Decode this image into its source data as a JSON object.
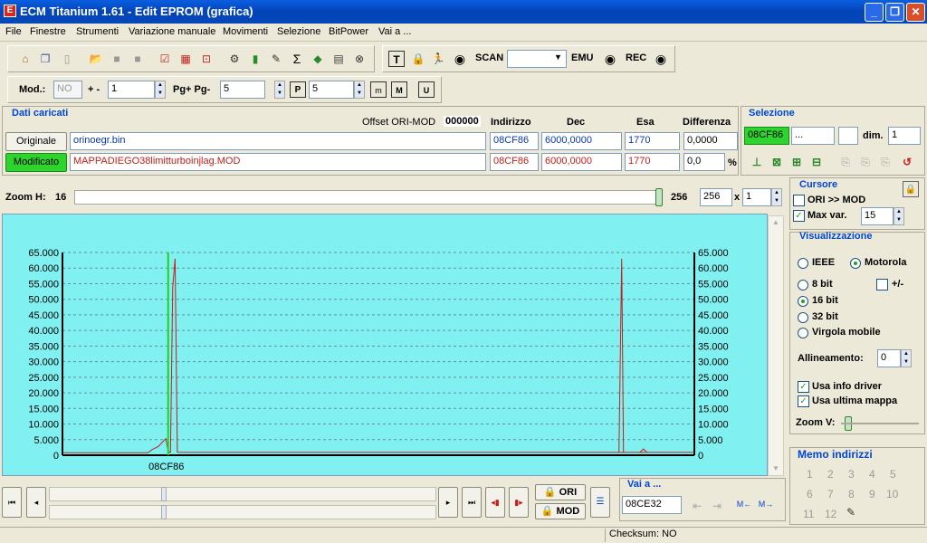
{
  "window": {
    "title": "ECM Titanium 1.61 - Edit EPROM (grafica)",
    "min": "_",
    "max": "❐",
    "close": "✕"
  },
  "menu": [
    "File",
    "Finestre",
    "Strumenti",
    "Variazione manuale",
    "Movimenti",
    "Selezione",
    "BitPower",
    "Vai a ..."
  ],
  "toolbar1": {
    "scan_label": "SCAN",
    "emu_label": "EMU",
    "rec_label": "REC",
    "scan_value": ""
  },
  "toolbar2": {
    "mod_label": "Mod.:",
    "mod_value": "NO",
    "pm_label": "+ -",
    "pm_value": "1",
    "pg_label": "Pg+ Pg-",
    "pg_value": "5",
    "p_value": "5"
  },
  "dati": {
    "title": "Dati caricati",
    "offset_label": "Offset ORI-MOD",
    "offset_value": "000000",
    "col_indirizzo": "Indirizzo",
    "col_dec": "Dec",
    "col_esa": "Esa",
    "col_diff": "Differenza",
    "originale": {
      "label": "Originale",
      "file": "orinoegr.bin",
      "indirizzo": "08CF86",
      "dec": "6000,0000",
      "esa": "1770",
      "diff": "0,0000"
    },
    "modificato": {
      "label": "Modificato",
      "file": "MAPPADIEGO38limitturboinjlag.MOD",
      "indirizzo": "08CF86",
      "dec": "6000,0000",
      "esa": "1770",
      "diff": "0,0",
      "pct": "%"
    }
  },
  "selezione": {
    "title": "Selezione",
    "start": "08CF86",
    "end": "...",
    "dim_label": "dim.",
    "dim_value": "1"
  },
  "zoom": {
    "label": "Zoom H:",
    "value": "16",
    "right_value": "256",
    "field_value": "256",
    "x_label": "x",
    "mult_value": "1"
  },
  "cursore": {
    "title": "Cursore",
    "ori_mod": "ORI >> MOD",
    "max_var": "Max var.",
    "max_var_value": "15"
  },
  "visualizzazione": {
    "title": "Visualizzazione",
    "ieee": "IEEE",
    "motorola": "Motorola",
    "b8": "8 bit",
    "pm": "+/-",
    "b16": "16 bit",
    "b32": "32 bit",
    "virgola": "Virgola mobile",
    "allineamento": "Allineamento:",
    "allineamento_value": "0",
    "usa_info": "Usa info driver",
    "usa_ultima": "Usa ultima mappa",
    "zoom_v": "Zoom V:"
  },
  "memo": {
    "title": "Memo indirizzi",
    "items": [
      "1",
      "2",
      "3",
      "4",
      "5",
      "6",
      "7",
      "8",
      "9",
      "10",
      "11",
      "12"
    ]
  },
  "bottom": {
    "ori_label": "ORI",
    "mod_label": "MOD",
    "vai_title": "Vai a ...",
    "vai_value": "08CE32"
  },
  "status": {
    "checksum": "Checksum: NO"
  },
  "chart_data": {
    "type": "line",
    "x_label_center": "08CF86",
    "ylim": [
      0,
      65000
    ],
    "yticks": [
      "0",
      "5.000",
      "10.000",
      "15.000",
      "20.000",
      "25.000",
      "30.000",
      "35.000",
      "40.000",
      "45.000",
      "50.000",
      "55.000",
      "60.000",
      "65.000"
    ],
    "cursor_index": 46,
    "values": [
      800,
      800,
      800,
      800,
      800,
      800,
      800,
      800,
      800,
      800,
      800,
      800,
      800,
      800,
      800,
      800,
      800,
      800,
      800,
      800,
      800,
      800,
      800,
      800,
      800,
      800,
      800,
      800,
      800,
      800,
      800,
      800,
      800,
      800,
      800,
      800,
      800,
      800,
      1200,
      1800,
      2200,
      2500,
      3000,
      3800,
      4600,
      5300,
      1200,
      900,
      54000,
      63000,
      1000,
      900,
      900,
      900,
      900,
      900,
      900,
      900,
      900,
      900,
      900,
      900,
      900,
      900,
      900,
      900,
      900,
      900,
      900,
      900,
      900,
      900,
      900,
      900,
      900,
      900,
      900,
      900,
      900,
      900,
      900,
      900,
      900,
      900,
      900,
      900,
      900,
      900,
      900,
      900,
      900,
      900,
      900,
      900,
      900,
      900,
      900,
      900,
      900,
      900,
      900,
      900,
      900,
      900,
      900,
      900,
      900,
      900,
      900,
      900,
      900,
      900,
      900,
      900,
      900,
      900,
      900,
      900,
      900,
      900,
      900,
      900,
      900,
      900,
      900,
      900,
      900,
      900,
      900,
      900,
      900,
      900,
      900,
      900,
      900,
      900,
      900,
      900,
      900,
      900,
      900,
      900,
      900,
      900,
      900,
      900,
      900,
      900,
      900,
      900,
      900,
      900,
      900,
      900,
      900,
      900,
      900,
      900,
      900,
      900,
      900,
      900,
      900,
      900,
      900,
      900,
      900,
      900,
      900,
      900,
      900,
      900,
      900,
      900,
      900,
      900,
      900,
      900,
      900,
      900,
      900,
      900,
      900,
      900,
      900,
      900,
      900,
      900,
      900,
      900,
      900,
      900,
      900,
      900,
      900,
      900,
      900,
      900,
      900,
      900,
      900,
      900,
      900,
      900,
      900,
      900,
      900,
      900,
      900,
      900,
      900,
      900,
      900,
      900,
      900,
      900,
      900,
      900,
      900,
      900,
      900,
      900,
      900,
      900,
      900,
      900,
      900,
      900,
      900,
      900,
      900,
      900,
      900,
      900,
      900,
      900,
      900,
      900,
      900,
      900,
      900,
      900,
      900,
      900,
      900,
      900,
      900,
      900,
      900,
      900,
      900,
      900,
      900,
      900,
      900,
      900,
      900,
      900,
      900,
      900,
      900,
      900,
      900,
      900,
      900,
      900,
      900,
      900,
      900,
      900,
      900,
      900,
      900,
      900,
      900,
      900
    ]
  }
}
